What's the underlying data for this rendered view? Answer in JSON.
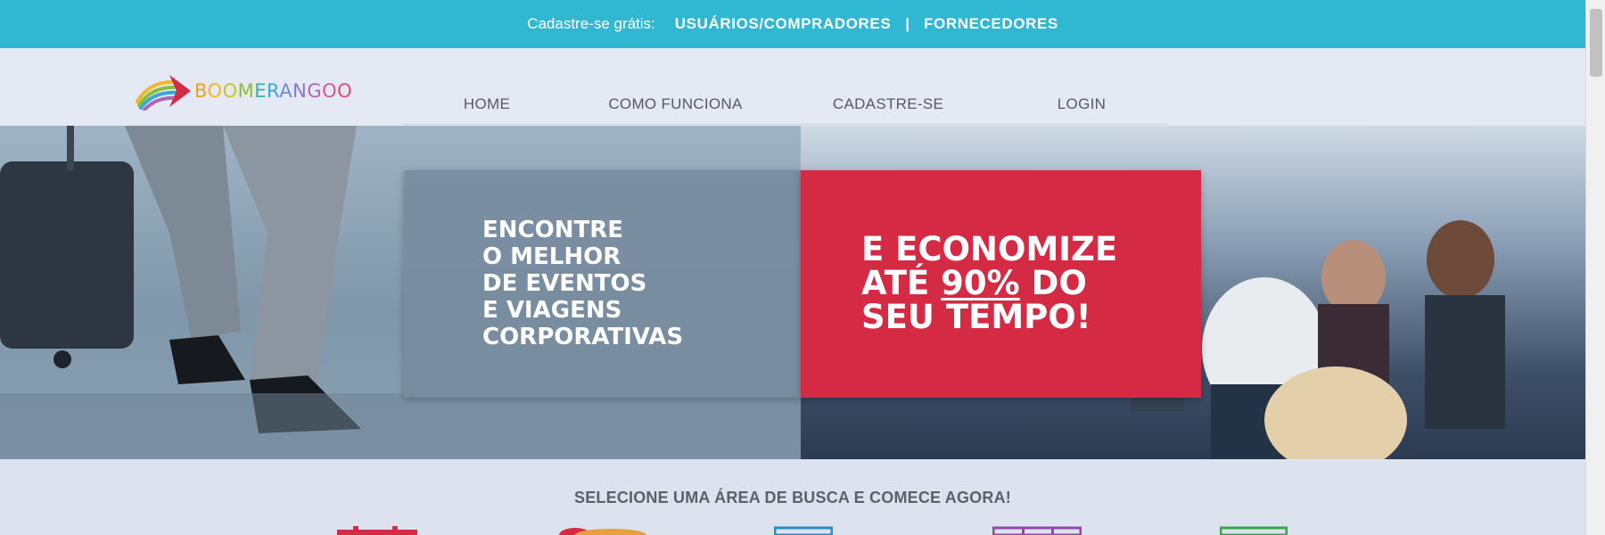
{
  "topbar": {
    "lead": "Cadastre-se grátis:",
    "link_users": "USUÁRIOS/COMPRADORES",
    "separator": "|",
    "link_suppliers": "FORNECEDORES",
    "bg_color": "#30b8d3"
  },
  "logo": {
    "letters": [
      {
        "char": "B",
        "color": "#e8a21e"
      },
      {
        "char": "O",
        "color": "#f0b72c"
      },
      {
        "char": "O",
        "color": "#c7c42a"
      },
      {
        "char": "M",
        "color": "#8bbd3a"
      },
      {
        "char": "E",
        "color": "#3ab39c"
      },
      {
        "char": "R",
        "color": "#3ba7d6"
      },
      {
        "char": "A",
        "color": "#6a8fd1"
      },
      {
        "char": "N",
        "color": "#8d76c6"
      },
      {
        "char": "G",
        "color": "#b066b6"
      },
      {
        "char": "O",
        "color": "#d25a93"
      },
      {
        "char": "O",
        "color": "#df4d72"
      }
    ]
  },
  "nav": {
    "home": "HOME",
    "como": "COMO FUNCIONA",
    "cadastre": "CADASTRE-SE",
    "login": "LOGIN"
  },
  "hero": {
    "left_lines": [
      "ENCONTRE",
      "O MELHOR",
      "DE EVENTOS",
      "E VIAGENS",
      "CORPORATIVAS"
    ],
    "right_line1": "E ECONOMIZE",
    "right_line2_pre": "ATÉ ",
    "right_line2_highlight": "90%",
    "right_line2_post": " DO",
    "right_line3": "SEU TEMPO!",
    "red_color": "#d42a43"
  },
  "section": {
    "title": "SELECIONE UMA ÁREA DE BUSCA E COMECE AGORA!"
  },
  "category_icons": [
    {
      "name": "calendar-icon",
      "color": "#d42a43"
    },
    {
      "name": "plane-icon",
      "color": "#d42a43"
    },
    {
      "name": "building-icon",
      "color": "#2a8ec0"
    },
    {
      "name": "grid-icon",
      "color": "#8e4aa6"
    },
    {
      "name": "screen-icon",
      "color": "#3aa54a"
    }
  ]
}
